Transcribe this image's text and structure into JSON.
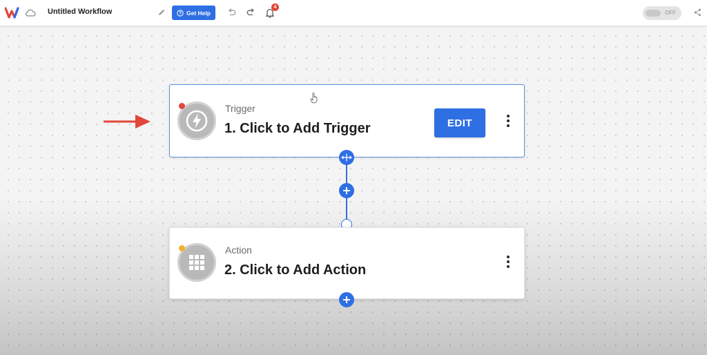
{
  "app": {
    "workflow_title": "Untitled Workflow",
    "help_label": "Get Help",
    "notification_count": "4",
    "toggle_label": "OFF"
  },
  "icons": {
    "logo": "app-logo",
    "cloud": "cloud-sync-icon",
    "edit_title": "pencil-icon",
    "help": "question-circle-icon",
    "undo": "undo-icon",
    "redo": "redo-icon",
    "notifications": "bell-icon",
    "share": "share-icon"
  },
  "workflow": {
    "trigger": {
      "kicker": "Trigger",
      "title": "1. Click to Add Trigger",
      "button": "EDIT",
      "status_color": "#e2463a",
      "icon": "lightning-icon"
    },
    "action": {
      "kicker": "Action",
      "title": "2. Click to Add Action",
      "status_color": "#f0b429",
      "icon": "app-grid-icon"
    }
  },
  "colors": {
    "accent": "#2f6fe4",
    "annotation_arrow": "#e2463a"
  }
}
